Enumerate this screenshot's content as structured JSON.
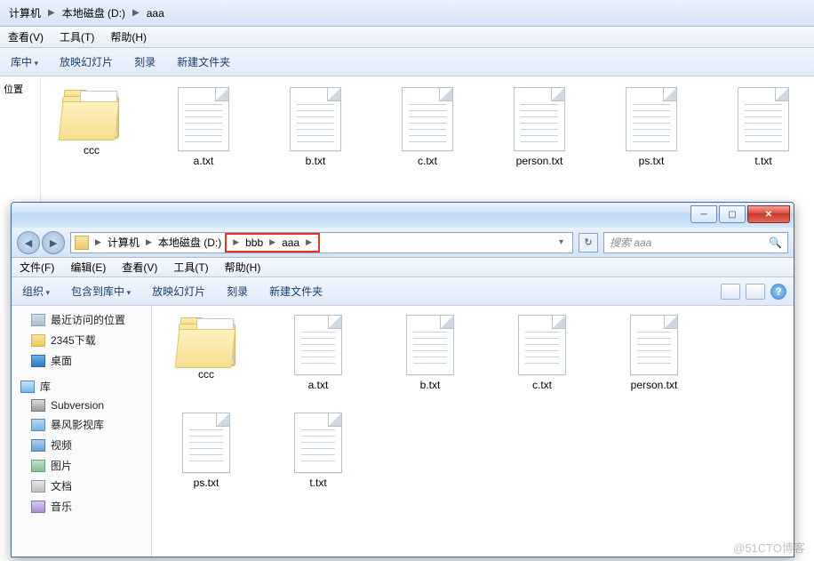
{
  "win1": {
    "address": {
      "seg1": "计算机",
      "seg2": "本地磁盘 (D:)",
      "seg3": "aaa"
    },
    "menu": {
      "view": "查看(V)",
      "tools": "工具(T)",
      "help": "帮助(H)"
    },
    "toolbar": {
      "lib": "库中",
      "slideshow": "放映幻灯片",
      "burn": "刻录",
      "newfolder": "新建文件夹"
    },
    "sidebar": {
      "loc": "位置"
    },
    "files": [
      "ccc",
      "a.txt",
      "b.txt",
      "c.txt",
      "person.txt",
      "ps.txt",
      "t.txt"
    ]
  },
  "win2": {
    "address": {
      "seg1": "计算机",
      "seg2": "本地磁盘 (D:)",
      "seg3": "bbb",
      "seg4": "aaa"
    },
    "search_placeholder": "搜索 aaa",
    "menu": {
      "file": "文件(F)",
      "edit": "编辑(E)",
      "view": "查看(V)",
      "tools": "工具(T)",
      "help": "帮助(H)"
    },
    "toolbar": {
      "org": "组织",
      "lib": "包含到库中",
      "slideshow": "放映幻灯片",
      "burn": "刻录",
      "newfolder": "新建文件夹"
    },
    "tree": {
      "recent": "最近访问的位置",
      "dl2345": "2345下载",
      "desktop": "桌面",
      "lib": "库",
      "svn": "Subversion",
      "storm": "暴风影视库",
      "video": "视频",
      "pic": "图片",
      "doc": "文档",
      "music": "音乐"
    },
    "files": [
      "ccc",
      "a.txt",
      "b.txt",
      "c.txt",
      "person.txt",
      "ps.txt",
      "t.txt"
    ]
  },
  "watermark": "@51CTO博客"
}
